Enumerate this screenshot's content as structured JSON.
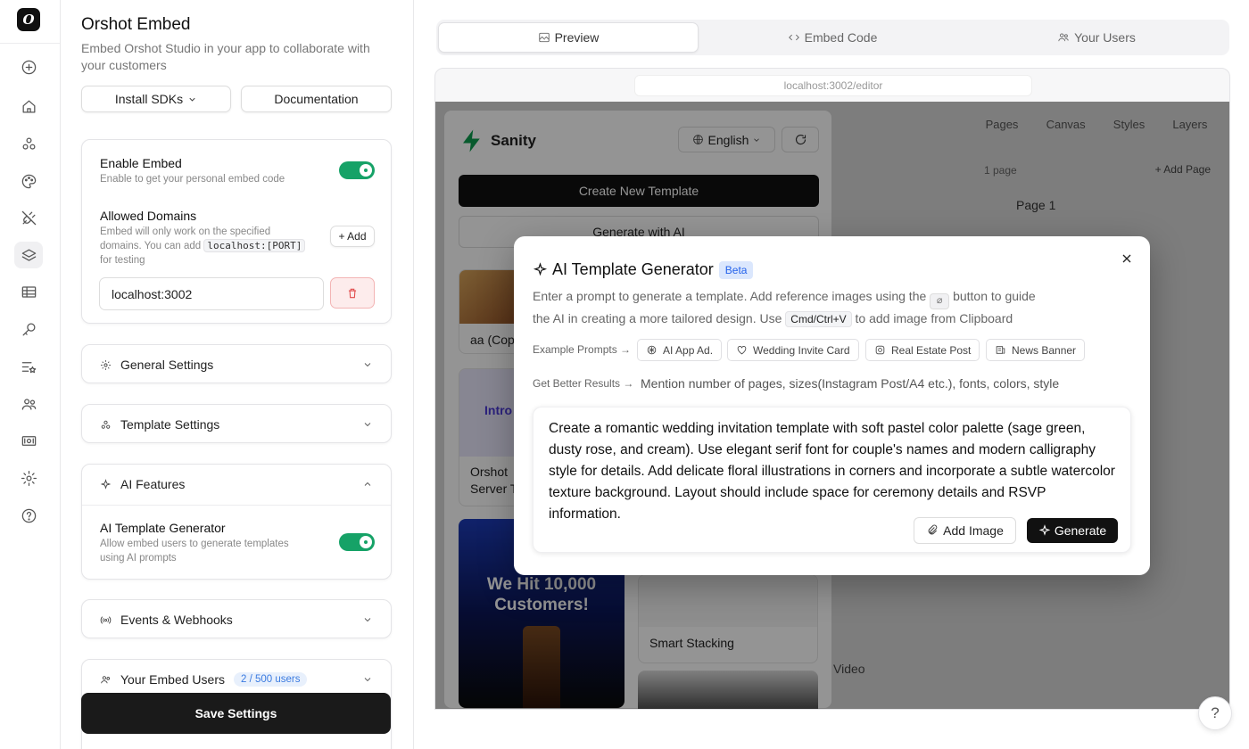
{
  "sidebar": {
    "logo_letter": "O",
    "items": [
      {
        "icon": "plus-circle-icon"
      },
      {
        "icon": "home-icon"
      },
      {
        "icon": "shapes-icon"
      },
      {
        "icon": "palette-icon"
      },
      {
        "icon": "plug-icon"
      },
      {
        "icon": "layers-icon",
        "active": true
      },
      {
        "icon": "table-icon"
      },
      {
        "icon": "key-icon"
      },
      {
        "icon": "list-star-icon"
      },
      {
        "icon": "users-icon"
      },
      {
        "icon": "billing-icon"
      },
      {
        "icon": "gear-icon"
      },
      {
        "icon": "help-circle-icon"
      }
    ]
  },
  "settings": {
    "title": "Orshot Embed",
    "subtitle": "Embed Orshot Studio in your app to collaborate with your customers",
    "install_sdks": "Install SDKs",
    "documentation": "Documentation",
    "enable_embed": {
      "label": "Enable Embed",
      "hint": "Enable to get your personal embed code",
      "on": true
    },
    "allowed_domains": {
      "label": "Allowed Domains",
      "hint_a": "Embed will only work on the specified",
      "hint_b": "domains. You can add",
      "hint_code": "localhost:[PORT]",
      "hint_c": "for testing",
      "add_label": "+ Add",
      "domain_value": "localhost:3002"
    },
    "sections": {
      "general": "General Settings",
      "template": "Template Settings",
      "ai": "AI Features",
      "events": "Events & Webhooks",
      "users": "Your Embed Users",
      "users_badge": "2 / 500 users"
    },
    "ai_generator": {
      "label": "AI Template Generator",
      "hint": "Allow embed users to generate templates using AI prompts",
      "on": true
    },
    "save": "Save Settings"
  },
  "main": {
    "tabs": [
      {
        "label": "Preview",
        "icon": "image-icon"
      },
      {
        "label": "Embed Code",
        "icon": "code-icon"
      },
      {
        "label": "Your Users",
        "icon": "users-icon"
      }
    ],
    "url": "localhost:3002/editor"
  },
  "studio": {
    "brand": "Sanity",
    "language": "English",
    "create_template": "Create New Template",
    "generate_ai": "Generate with AI",
    "right_tabs": [
      "Pages",
      "Canvas",
      "Styles",
      "Layers"
    ],
    "page_count": "1 page",
    "add_page": "Add Page",
    "page_name": "Page 1",
    "cards": {
      "card1_label": "aa (Cop",
      "card2_line1": "Orshot",
      "card2_line2": "Server T",
      "card2_img_text": "Intro Remo",
      "card3_text": "We Hit 10,000 Customers!",
      "smart_stacking": "Smart Stacking"
    },
    "video_label": "Video"
  },
  "modal": {
    "title": "AI Template Generator",
    "badge": "Beta",
    "desc1": "Enter a prompt to generate a template. Add reference images using the",
    "desc2": "button to guide",
    "desc3": "the AI in creating a more tailored design. Use",
    "desc_code": "Cmd/Ctrl+V",
    "desc4": "to add image from Clipboard",
    "example_label": "Example Prompts →",
    "examples": [
      "AI App Ad.",
      "Wedding Invite Card",
      "Real Estate Post",
      "News Banner"
    ],
    "better_label": "Get Better Results →",
    "better_text": "Mention number of pages, sizes(Instagram Post/A4 etc.), fonts, colors, style",
    "prompt": "Create a romantic wedding invitation template with soft pastel color palette (sage green, dusty rose, and cream). Use elegant serif font for couple's names and modern calligraphy style for details. Add delicate floral illustrations in corners and incorporate a subtle watercolor texture background. Layout should include space for ceremony details and RSVP information.",
    "add_image": "Add Image",
    "generate": "Generate"
  },
  "help_label": "?"
}
